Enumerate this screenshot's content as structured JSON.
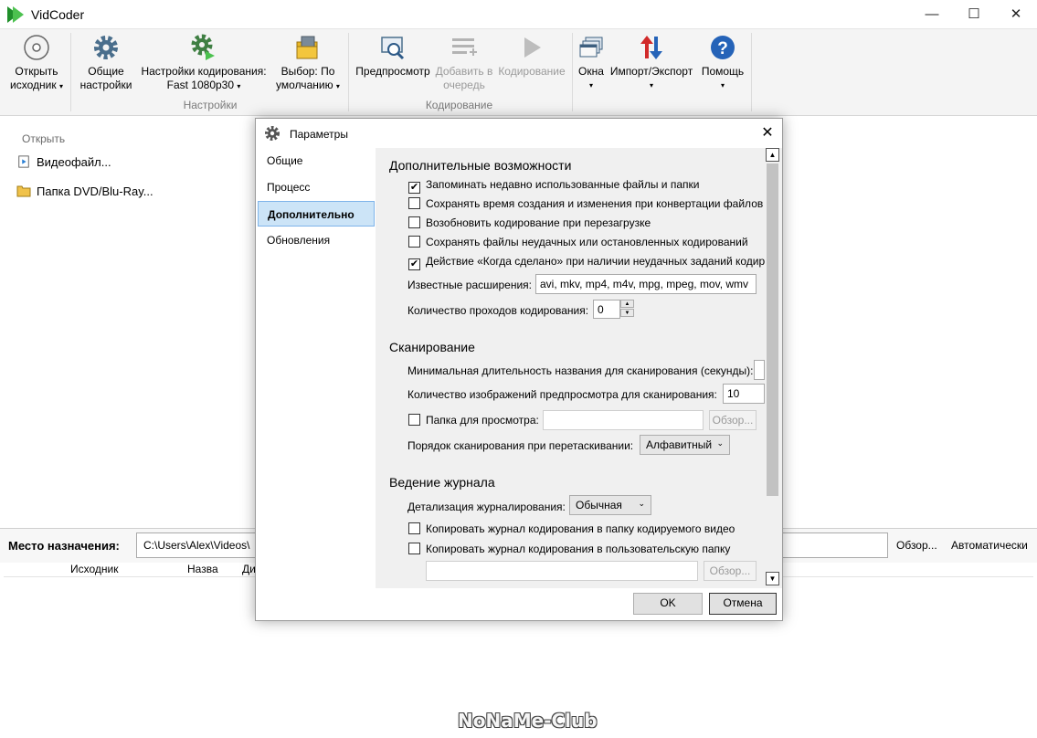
{
  "window": {
    "title": "VidCoder",
    "minimize": "—",
    "maximize": "☐",
    "close": "✕"
  },
  "ribbon": {
    "open_source": {
      "line1": "Открыть",
      "line2": "исходник",
      "icon": "disc-icon"
    },
    "general_settings": {
      "line1": "Общие",
      "line2": "настройки",
      "icon": "gear-icon"
    },
    "encoding_settings": {
      "line1": "Настройки кодирования:",
      "line2": "Fast 1080p30",
      "icon": "gear-film-icon"
    },
    "pick_default": {
      "line1": "Выбор: По",
      "line2": "умолчанию",
      "icon": "folder-pick-icon"
    },
    "group_settings": "Настройки",
    "preview": {
      "line1": "Предпросмотр",
      "icon": "preview-icon"
    },
    "add_to_queue": {
      "line1": "Добавить в",
      "line2": "очередь",
      "icon": "add-queue-icon"
    },
    "encode": {
      "line1": "Кодирование",
      "icon": "play-icon"
    },
    "group_encoding": "Кодирование",
    "windows": {
      "line1": "Окна",
      "icon": "windows-icon"
    },
    "import_export": {
      "line1": "Импорт/Экспорт",
      "icon": "import-export-icon"
    },
    "help": {
      "line1": "Помощь",
      "icon": "help-icon"
    },
    "caret": "▾"
  },
  "open_panel": {
    "header": "Открыть",
    "items": [
      "Видеофайл...",
      "Папка DVD/Blu-Ray..."
    ]
  },
  "destination": {
    "label": "Место назначения:",
    "path": "C:\\Users\\Alex\\Videos\\",
    "browse": "Обзор...",
    "auto": "Автоматически"
  },
  "queue": {
    "columns": [
      "Исходник",
      "Назва",
      "Ди"
    ]
  },
  "watermark": "NoNaMe-Club",
  "dialog": {
    "title": "Параметры",
    "close": "✕",
    "nav": [
      "Общие",
      "Процесс",
      "Дополнительно",
      "Обновления"
    ],
    "selected_nav": "Дополнительно",
    "advanced": {
      "heading": "Дополнительные возможности",
      "checkboxes": [
        {
          "label": "Запоминать недавно использованные файлы и папки",
          "checked": "✔"
        },
        {
          "label": "Сохранять время создания и изменения при конвертации файлов",
          "checked": ""
        },
        {
          "label": "Возобновить кодирование при перезагрузке",
          "checked": ""
        },
        {
          "label": "Сохранять файлы неудачных или остановленных кодирований",
          "checked": ""
        },
        {
          "label": "Действие «Когда сделано» при наличии неудачных заданий кодир",
          "checked": "✔"
        }
      ],
      "extensions_label": "Известные расширения:",
      "extensions_value": "avi, mkv, mp4, m4v, mpg, mpeg, mov, wmv",
      "passes_label": "Количество проходов кодирования:",
      "passes_value": "0"
    },
    "scanning": {
      "heading": "Сканирование",
      "min_duration_label": "Минимальная длительность названия для сканирования (секунды):",
      "previews_label": "Количество изображений предпросмотра для сканирования:",
      "previews_value": "10",
      "watch_folder_label": "Папка для просмотра:",
      "watch_folder_browse": "Обзор...",
      "drag_order_label": "Порядок сканирования при перетаскивании:",
      "drag_order_value": "Алфавитный"
    },
    "logging": {
      "heading": "Ведение журнала",
      "verbosity_label": "Детализация журналирования:",
      "verbosity_value": "Обычная",
      "copy_to_video": "Копировать журнал кодирования в папку кодируемого видео",
      "copy_to_custom": "Копировать журнал кодирования в пользовательскую папку",
      "custom_browse": "Обзор..."
    },
    "ok": "OK",
    "cancel": "Отмена"
  },
  "colors": {
    "accent": "#cce4f7",
    "scroll_thumb": "#c2c2c2"
  }
}
